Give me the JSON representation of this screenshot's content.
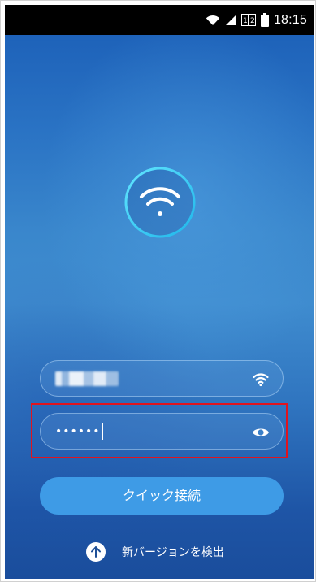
{
  "status_bar": {
    "time": "18:15",
    "icons": [
      "wifi-icon",
      "signal-icon",
      "sim-icon",
      "battery-icon"
    ]
  },
  "logo": {
    "icon": "wifi-icon"
  },
  "ssid_field": {
    "value": "████ ███",
    "icon": "wifi-icon"
  },
  "password_field": {
    "value": "••••••",
    "icon": "eye-icon"
  },
  "connect_button": {
    "label": "クイック接続"
  },
  "update": {
    "icon": "arrow-up-icon",
    "label": "新バージョンを検出"
  },
  "colors": {
    "accent": "#3e9be6",
    "highlight": "#e0141e",
    "logo_ring": "#35d0f0"
  }
}
